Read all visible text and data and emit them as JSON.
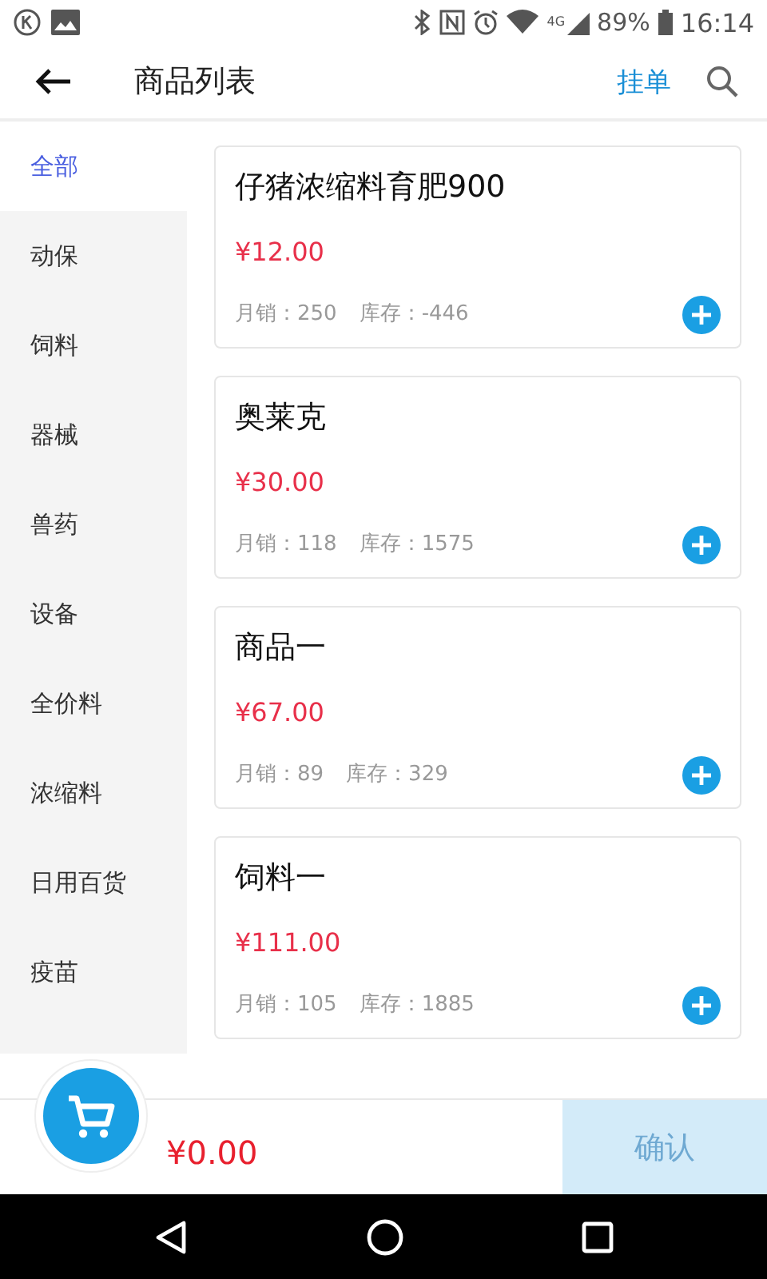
{
  "status_bar": {
    "network": "4G",
    "battery": "89%",
    "time": "16:14"
  },
  "header": {
    "title": "商品列表",
    "action": "挂单"
  },
  "categories": [
    {
      "label": "全部",
      "selected": true
    },
    {
      "label": "动保",
      "selected": false
    },
    {
      "label": "饲料",
      "selected": false
    },
    {
      "label": "器械",
      "selected": false
    },
    {
      "label": "兽药",
      "selected": false
    },
    {
      "label": "设备",
      "selected": false
    },
    {
      "label": "全价料",
      "selected": false
    },
    {
      "label": "浓缩料",
      "selected": false
    },
    {
      "label": "日用百货",
      "selected": false
    },
    {
      "label": "疫苗",
      "selected": false
    }
  ],
  "products": [
    {
      "name": "仔猪浓缩料育肥900",
      "price": "¥12.00",
      "sales_label": "月销：",
      "sales": "250",
      "stock_label": "库存：",
      "stock": "-446"
    },
    {
      "name": "奥莱克",
      "price": "¥30.00",
      "sales_label": "月销：",
      "sales": "118",
      "stock_label": "库存：",
      "stock": "1575"
    },
    {
      "name": "商品一",
      "price": "¥67.00",
      "sales_label": "月销：",
      "sales": "89",
      "stock_label": "库存：",
      "stock": "329"
    },
    {
      "name": "饲料一",
      "price": "¥111.00",
      "sales_label": "月销：",
      "sales": "105",
      "stock_label": "库存：",
      "stock": "1885"
    }
  ],
  "cart": {
    "total": "¥0.00",
    "confirm": "确认",
    "confirm_disabled": true
  }
}
